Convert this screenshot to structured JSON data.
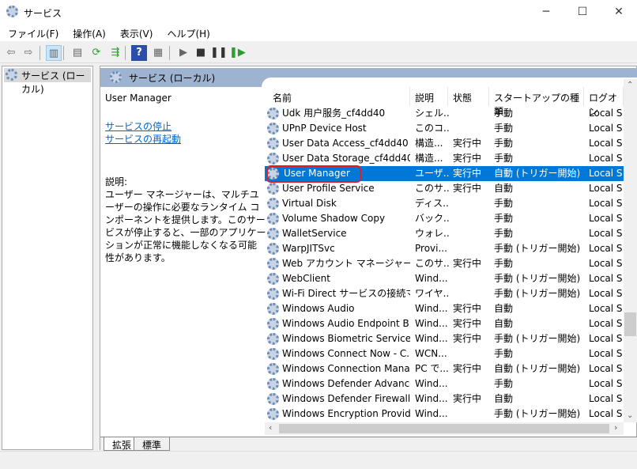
{
  "window": {
    "title": "サービス",
    "minimize": "─",
    "maximize": "☐",
    "close": "✕"
  },
  "menu": [
    "ファイル(F)",
    "操作(A)",
    "表示(V)",
    "ヘルプ(H)"
  ],
  "toolbar": [
    {
      "icon": "back-arrow-icon",
      "glyph": "⇦"
    },
    {
      "icon": "forward-arrow-icon",
      "glyph": "⇨"
    },
    {
      "icon": "show-hide-console-tree-icon",
      "glyph": "▥"
    },
    {
      "icon": "properties-icon",
      "glyph": "▤"
    },
    {
      "icon": "refresh-icon",
      "glyph": "⟳"
    },
    {
      "icon": "export-list-icon",
      "glyph": "⇶"
    },
    {
      "icon": "help-icon",
      "glyph": "?"
    },
    {
      "icon": "action-pane-icon",
      "glyph": "▦"
    },
    {
      "icon": "start-icon",
      "glyph": "▶"
    },
    {
      "icon": "stop-icon",
      "glyph": "■"
    },
    {
      "icon": "pause-icon",
      "glyph": "❚❚"
    },
    {
      "icon": "restart-icon",
      "glyph": "❚▶"
    }
  ],
  "tree": {
    "selected": "サービス (ローカル)"
  },
  "panel": {
    "title": "サービス (ローカル)"
  },
  "details": {
    "service_name": "User Manager",
    "stop_link": "サービスの停止",
    "restart_link": "サービスの再起動",
    "desc_label": "説明:",
    "description": "ユーザー マネージャーは、マルチユーザーの操作に必要なランタイム コンポーネントを提供します。このサービスが停止すると、一部のアプリケーションが正常に機能しなくなる可能性があります。"
  },
  "columns": [
    "名前",
    "説明",
    "状態",
    "スタートアップの種類",
    "ログオン"
  ],
  "rows": [
    [
      "Udk 用户服务_cf4dd40",
      "シェル...",
      "",
      "手動",
      "Local S"
    ],
    [
      "UPnP Device Host",
      "このコ...",
      "",
      "手動",
      "Local S"
    ],
    [
      "User Data Access_cf4dd40",
      "構造...",
      "実行中",
      "手動",
      "Local S"
    ],
    [
      "User Data Storage_cf4dd40",
      "構造...",
      "実行中",
      "手動",
      "Local S"
    ],
    [
      "User Manager",
      "ユーザ...",
      "実行中",
      "自動 (トリガー開始)",
      "Local S"
    ],
    [
      "User Profile Service",
      "このサ...",
      "実行中",
      "自動",
      "Local S"
    ],
    [
      "Virtual Disk",
      "ディス...",
      "",
      "手動",
      "Local S"
    ],
    [
      "Volume Shadow Copy",
      "バック...",
      "",
      "手動",
      "Local S"
    ],
    [
      "WalletService",
      "ウォレ...",
      "",
      "手動",
      "Local S"
    ],
    [
      "WarpJITSvc",
      "Provi...",
      "",
      "手動 (トリガー開始)",
      "Local S"
    ],
    [
      "Web アカウント マネージャー",
      "このサ...",
      "実行中",
      "手動",
      "Local S"
    ],
    [
      "WebClient",
      "Wind...",
      "",
      "手動 (トリガー開始)",
      "Local S"
    ],
    [
      "Wi-Fi Direct サービスの接続マ...",
      "ワイヤ...",
      "",
      "手動 (トリガー開始)",
      "Local S"
    ],
    [
      "Windows Audio",
      "Wind...",
      "実行中",
      "自動",
      "Local S"
    ],
    [
      "Windows Audio Endpoint B...",
      "Wind...",
      "実行中",
      "自動",
      "Local S"
    ],
    [
      "Windows Biometric Service",
      "Wind...",
      "実行中",
      "手動 (トリガー開始)",
      "Local S"
    ],
    [
      "Windows Connect Now - C...",
      "WCN...",
      "",
      "手動",
      "Local S"
    ],
    [
      "Windows Connection Mana...",
      "PC で...",
      "実行中",
      "自動 (トリガー開始)",
      "Local S"
    ],
    [
      "Windows Defender Advanc...",
      "Wind...",
      "",
      "手動",
      "Local S"
    ],
    [
      "Windows Defender Firewall",
      "Wind...",
      "実行中",
      "自動",
      "Local S"
    ],
    [
      "Windows Encryption Provid...",
      "Wind...",
      "",
      "手動 (トリガー開始)",
      "Local S"
    ]
  ],
  "selected_row": 4,
  "tabs": [
    "拡張",
    "標準"
  ],
  "colors": {
    "selection": "#0078d7",
    "highlight_box": "#e02020",
    "link": "#0066cc"
  }
}
